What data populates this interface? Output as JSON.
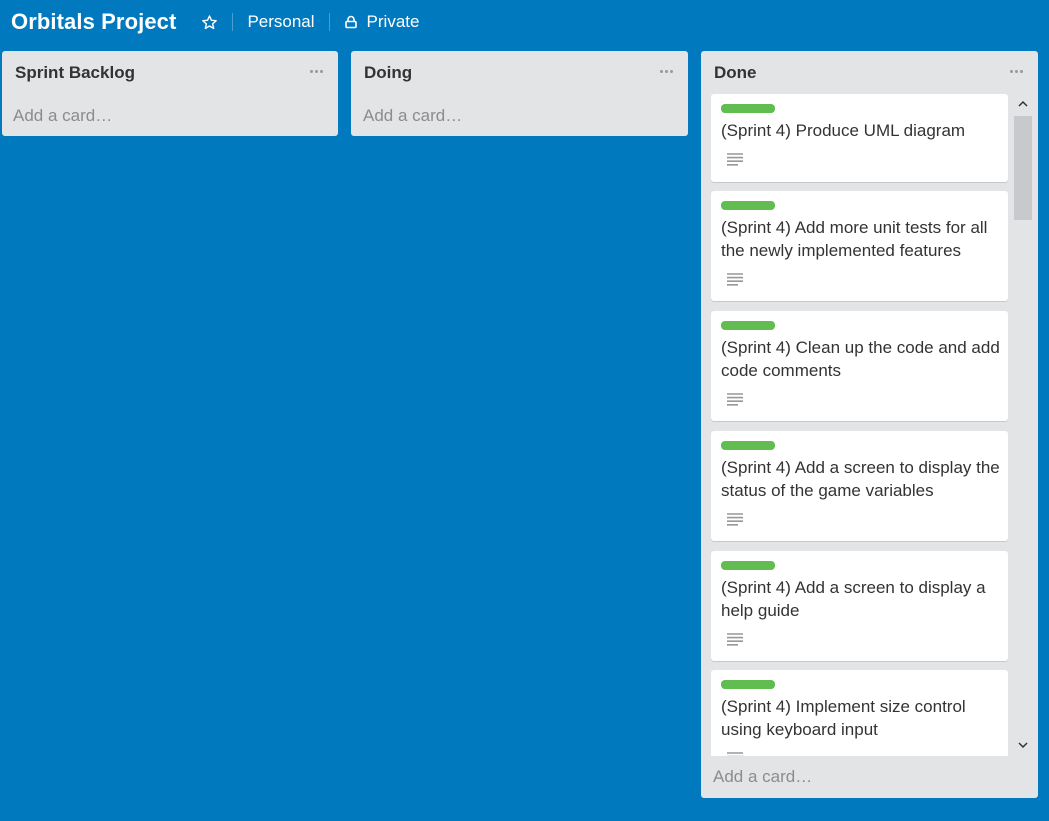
{
  "board": {
    "title": "Orbitals Project",
    "team": "Personal",
    "visibility": "Private",
    "background_color": "#0079bf"
  },
  "icons": {
    "star": "star-icon",
    "lock": "lock-icon",
    "list_menu": "ellipsis-icon",
    "description": "description-icon",
    "scroll_up": "chevron-up-icon",
    "scroll_down": "chevron-down-icon"
  },
  "label_color": "#61bd4f",
  "lists": [
    {
      "title": "Sprint Backlog",
      "add_card": "Add a card…"
    },
    {
      "title": "Doing",
      "add_card": "Add a card…"
    },
    {
      "title": "Done",
      "add_card": "Add a card…",
      "cards": [
        {
          "title": "(Sprint 4) Produce UML diagram",
          "label": "green"
        },
        {
          "title": "(Sprint 4) Add more unit tests for all the newly implemented features",
          "label": "green"
        },
        {
          "title": "(Sprint 4) Clean up the code and add code comments",
          "label": "green"
        },
        {
          "title": "(Sprint 4) Add a screen to display the status of the game variables",
          "label": "green"
        },
        {
          "title": "(Sprint 4) Add a screen to display a help guide",
          "label": "green"
        },
        {
          "title": "(Sprint 4) Implement size control using keyboard input",
          "label": "green"
        }
      ]
    }
  ]
}
